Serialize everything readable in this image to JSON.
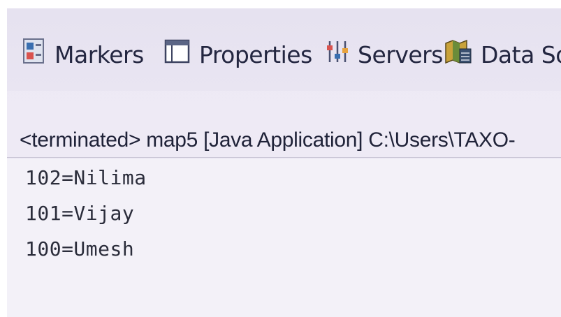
{
  "tabs": [
    {
      "label": "Markers",
      "icon": "markers-icon"
    },
    {
      "label": "Properties",
      "icon": "properties-icon"
    },
    {
      "label": "Servers",
      "icon": "servers-icon"
    },
    {
      "label": "Data Sou",
      "icon": "data-source-icon"
    }
  ],
  "console": {
    "header": "<terminated> map5 [Java Application] C:\\Users\\TAXO-",
    "lines": [
      "102=Nilima",
      "101=Vijay",
      "100=Umesh"
    ]
  },
  "colors": {
    "background": "#eeeaf5",
    "text": "#232640",
    "marker_red": "#d9534f",
    "marker_blue": "#3a6fb0"
  }
}
